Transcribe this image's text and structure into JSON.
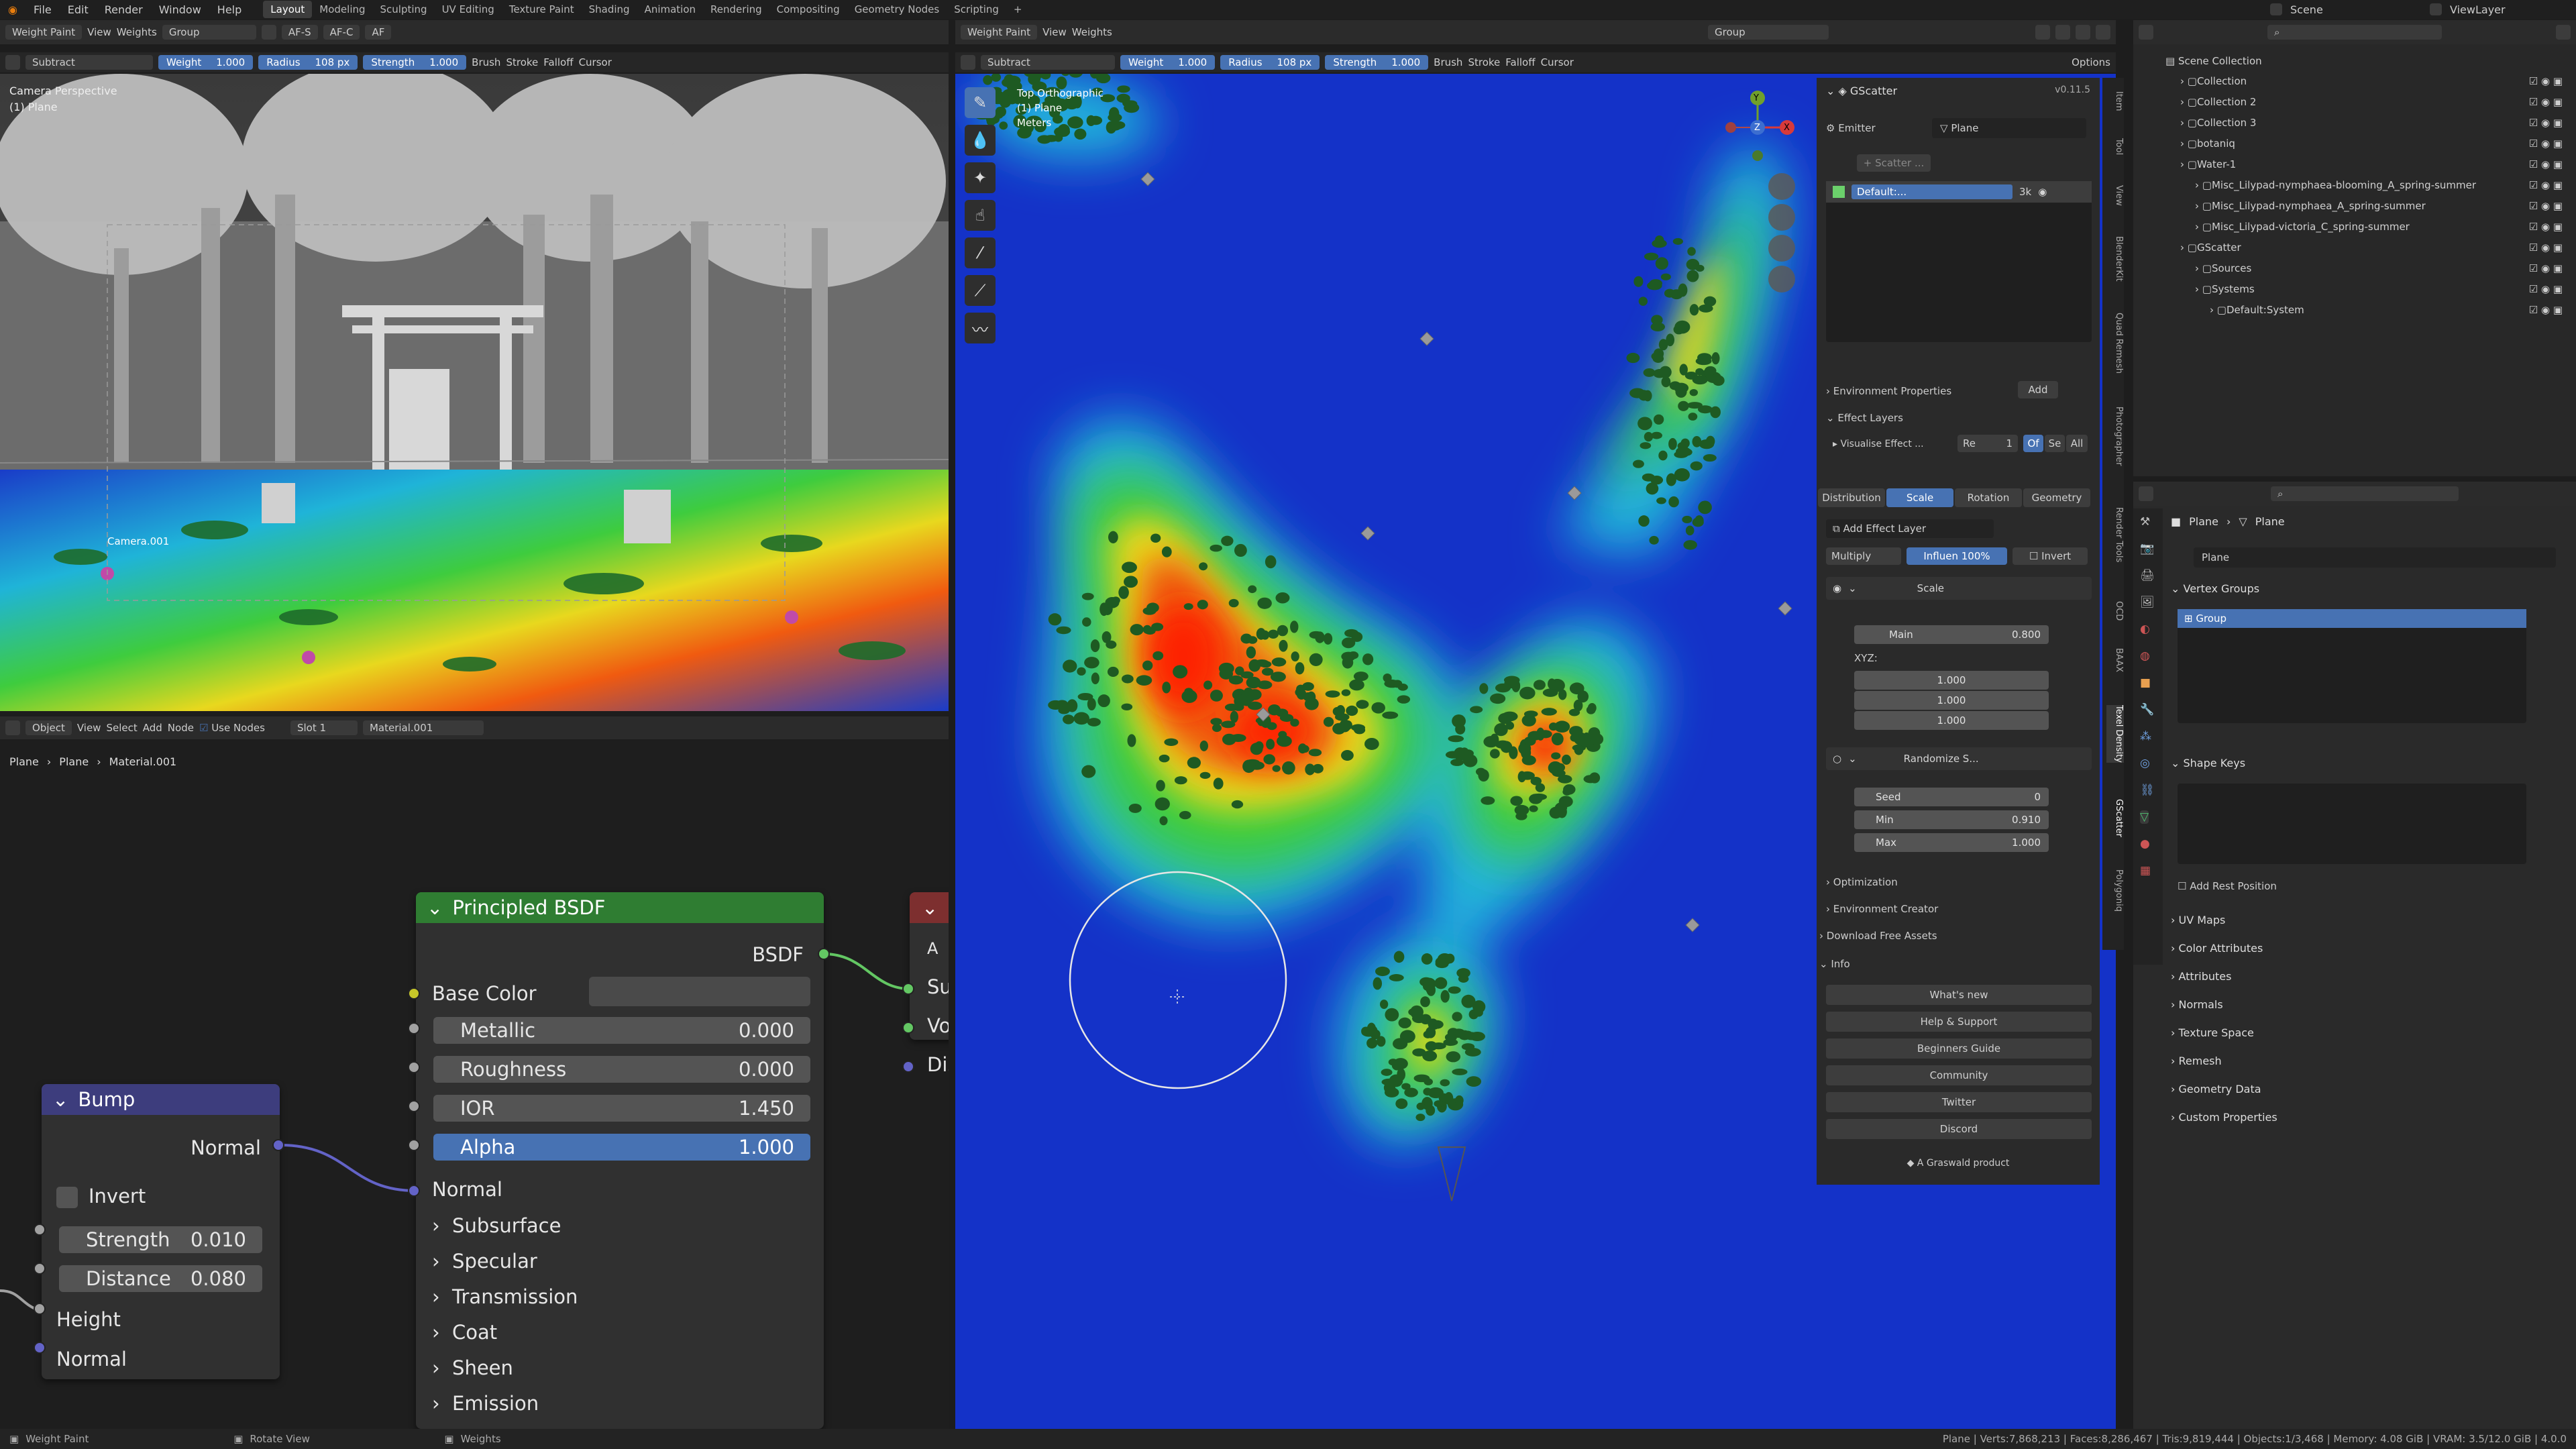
{
  "topbar": {
    "menus": [
      "File",
      "Edit",
      "Render",
      "Window",
      "Help"
    ],
    "workspaces": [
      "Layout",
      "Modeling",
      "Sculpting",
      "UV Editing",
      "Texture Paint",
      "Shading",
      "Animation",
      "Rendering",
      "Compositing",
      "Geometry Nodes",
      "Scripting"
    ],
    "active": "Layout",
    "plus": "+",
    "scene": "Scene",
    "view_layer": "ViewLayer"
  },
  "vp1": {
    "mode": "Weight Paint",
    "menus": [
      "View",
      "Weights"
    ],
    "group": "Group",
    "af_s": "AF-S",
    "af_c": "AF-C",
    "af": "AF",
    "tool_mode": "Subtract",
    "weight_label": "Weight",
    "weight": "1.000",
    "radius_label": "Radius",
    "radius": "108 px",
    "strength_label": "Strength",
    "strength": "1.000",
    "brush": "Brush",
    "stroke": "Stroke",
    "falloff": "Falloff",
    "cursor": "Cursor",
    "overlay_title": "Camera Perspective",
    "overlay_sub": "(1) Plane",
    "camera_label": "Camera.001"
  },
  "vp2": {
    "mode": "Weight Paint",
    "menus": [
      "View",
      "Weights"
    ],
    "group": "Group",
    "tool_mode": "Subtract",
    "weight_label": "Weight",
    "weight": "1.000",
    "radius_label": "Radius",
    "radius": "108 px",
    "strength_label": "Strength",
    "strength": "1.000",
    "brush": "Brush",
    "stroke": "Stroke",
    "falloff": "Falloff",
    "cursor": "Cursor",
    "options": "Options",
    "overlay_title": "Top Orthographic",
    "overlay_sub": "(1) Plane",
    "overlay_units": "Meters",
    "axes": {
      "x": "X",
      "y": "Y",
      "z": "Z"
    }
  },
  "node_editor": {
    "type": "Object",
    "menus": [
      "View",
      "Select",
      "Add",
      "Node"
    ],
    "use_nodes": "Use Nodes",
    "slot": "Slot 1",
    "material": "Material.001",
    "breadcrumb": [
      "Plane",
      "Plane",
      "Material.001"
    ]
  },
  "bsdf": {
    "title": "Principled BSDF",
    "output": "BSDF",
    "base_color": "Base Color",
    "metallic_label": "Metallic",
    "metallic": "0.000",
    "roughness_label": "Roughness",
    "roughness": "0.000",
    "ior_label": "IOR",
    "ior": "1.450",
    "alpha_label": "Alpha",
    "alpha": "1.000",
    "normal": "Normal",
    "sections": [
      "Subsurface",
      "Specular",
      "Transmission",
      "Coat",
      "Sheen",
      "Emission"
    ],
    "next_node_rows": [
      "A",
      "Su",
      "Vo",
      "Dis"
    ]
  },
  "bump": {
    "title": "Bump",
    "output": "Normal",
    "invert": "Invert",
    "strength_label": "Strength",
    "strength": "0.010",
    "distance_label": "Distance",
    "distance": "0.080",
    "height": "Height",
    "normal": "Normal"
  },
  "gscatter": {
    "title": "GScatter",
    "version": "v0.11.5",
    "emitter_label": "Emitter",
    "emitter": "Plane",
    "scatter_btn": "+ Scatter ...",
    "system": "Default:...",
    "system_count": "3k",
    "env_props": "Environment Properties",
    "add": "Add",
    "effect_layers": "Effect Layers",
    "visualise": "Visualise Effect ...",
    "re": "Re",
    "re_val": "1",
    "of": "Of",
    "se": "Se",
    "all": "All",
    "tabs": [
      "Distribution",
      "Scale",
      "Rotation",
      "Geometry"
    ],
    "active_tab": "Scale",
    "add_effect": "Add Effect Layer",
    "blend": "Multiply",
    "influence": "Influen  100%",
    "invert": "Invert",
    "layer1": "Scale",
    "main_label": "Main",
    "main": "0.800",
    "xyz": "XYZ:",
    "x": "1.000",
    "y": "1.000",
    "z": "1.000",
    "layer2": "Randomize S...",
    "seed_label": "Seed",
    "seed": "0",
    "min_label": "Min",
    "min": "0.910",
    "max_label": "Max",
    "max": "1.000",
    "optimization": "Optimization",
    "env_creator": "Environment Creator",
    "download": "Download Free Assets",
    "info": "Info",
    "links": [
      "What's new",
      "Help & Support",
      "Beginners Guide",
      "Community",
      "Twitter",
      "Discord"
    ],
    "footer": "A Graswald product"
  },
  "vtabs": [
    "Item",
    "Tool",
    "View",
    "BlenderKit",
    "Quad Remesh",
    "Photographer",
    "Render Tools",
    "OCD",
    "BAAX",
    "Texel Density",
    "GScatter",
    "Polygoniq"
  ],
  "outliner": {
    "root": "Scene Collection",
    "items": [
      {
        "name": "Collection",
        "level": 1
      },
      {
        "name": "Collection 2",
        "level": 1
      },
      {
        "name": "Collection 3",
        "level": 1
      },
      {
        "name": "botaniq",
        "level": 1
      },
      {
        "name": "Water-1",
        "level": 1
      },
      {
        "name": "Misc_Lilypad-nymphaea-blooming_A_spring-summer",
        "level": 2
      },
      {
        "name": "Misc_Lilypad-nymphaea_A_spring-summer",
        "level": 2
      },
      {
        "name": "Misc_Lilypad-victoria_C_spring-summer",
        "level": 2
      },
      {
        "name": "GScatter",
        "level": 1
      },
      {
        "name": "Sources",
        "level": 2
      },
      {
        "name": "Systems",
        "level": 2
      },
      {
        "name": "Default:System",
        "level": 3
      }
    ]
  },
  "props": {
    "breadcrumb": [
      "Plane",
      "Plane"
    ],
    "object": "Plane",
    "vertex_groups": "Vertex Groups",
    "group": "Group",
    "shape_keys": "Shape Keys",
    "add_rest": "Add Rest Position",
    "sections": [
      "UV Maps",
      "Color Attributes",
      "Attributes",
      "Normals",
      "Texture Space",
      "Remesh",
      "Geometry Data",
      "Custom Properties"
    ]
  },
  "status": {
    "left1": "Weight Paint",
    "left2": "Rotate View",
    "left3": "Weights",
    "right": "Plane | Verts:7,868,213 | Faces:8,286,467 | Tris:9,819,444 | Objects:1/3,468 | Memory: 4.08 GiB | VRAM: 3.5/12.0 GiB | 4.0.0"
  },
  "colors": {
    "accent": "#4772b3",
    "bsdf_header": "#2f7d32",
    "bump_header": "#3d3d7d",
    "heat_low": "#1432c8",
    "heat_high": "#ff1e00",
    "header_bg": "#2b2b2b",
    "panel_bg": "#303030"
  }
}
